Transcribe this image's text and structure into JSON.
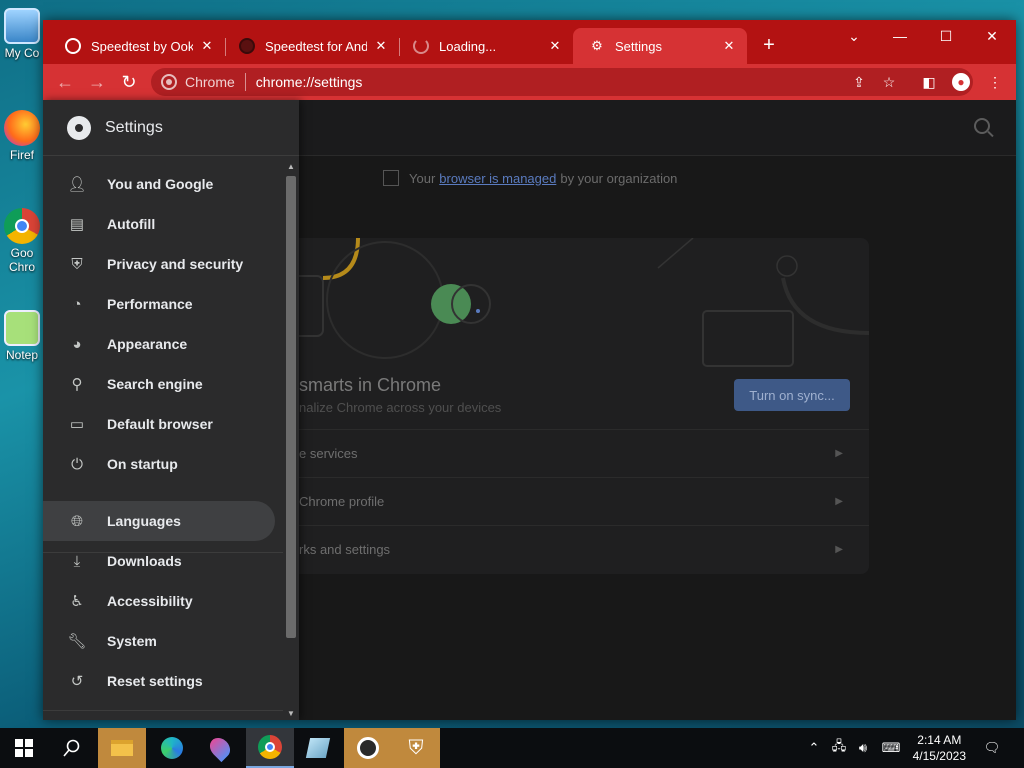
{
  "desktop": {
    "icons": [
      {
        "label": "My Co",
        "icon": "computer-icon"
      },
      {
        "label": "Firef",
        "icon": "firefox-icon"
      },
      {
        "label": "Goo",
        "label2": "Chro",
        "icon": "chrome-icon"
      },
      {
        "label": "Notep",
        "icon": "notepad-icon"
      }
    ]
  },
  "browser": {
    "tabs": [
      {
        "title": "Speedtest by Ookla",
        "icon": "speedtest-icon"
      },
      {
        "title": "Speedtest for Andro",
        "icon": "speedtest-icon"
      },
      {
        "title": "Loading...",
        "icon": "loading-spinner-icon"
      },
      {
        "title": "Settings",
        "icon": "gear-icon",
        "active": true
      }
    ],
    "omnibox": {
      "chip": "Chrome",
      "url": "chrome://settings"
    },
    "accent_color": "#d63234"
  },
  "settings": {
    "title": "Settings",
    "managed": {
      "prefix": "Your",
      "link": "browser is managed",
      "suffix": "by your organization"
    },
    "sync_card": {
      "title": "smarts in Chrome",
      "subtitle": "nalize Chrome across your devices",
      "button": "Turn on sync...",
      "rows": [
        "e services",
        "Chrome profile",
        "rks and settings"
      ]
    },
    "menu": [
      {
        "label": "You and Google",
        "icon": "person-icon"
      },
      {
        "label": "Autofill",
        "icon": "clipboard-icon"
      },
      {
        "label": "Privacy and security",
        "icon": "shield-icon"
      },
      {
        "label": "Performance",
        "icon": "speedometer-icon"
      },
      {
        "label": "Appearance",
        "icon": "palette-icon"
      },
      {
        "label": "Search engine",
        "icon": "search-icon"
      },
      {
        "label": "Default browser",
        "icon": "browser-icon"
      },
      {
        "label": "On startup",
        "icon": "power-icon"
      },
      {
        "label": "Languages",
        "icon": "globe-icon",
        "selected": true
      },
      {
        "label": "Downloads",
        "icon": "download-icon"
      },
      {
        "label": "Accessibility",
        "icon": "accessibility-icon"
      },
      {
        "label": "System",
        "icon": "wrench-icon"
      },
      {
        "label": "Reset settings",
        "icon": "history-icon"
      }
    ]
  },
  "taskbar": {
    "time": "2:14 AM",
    "date": "4/15/2023"
  }
}
